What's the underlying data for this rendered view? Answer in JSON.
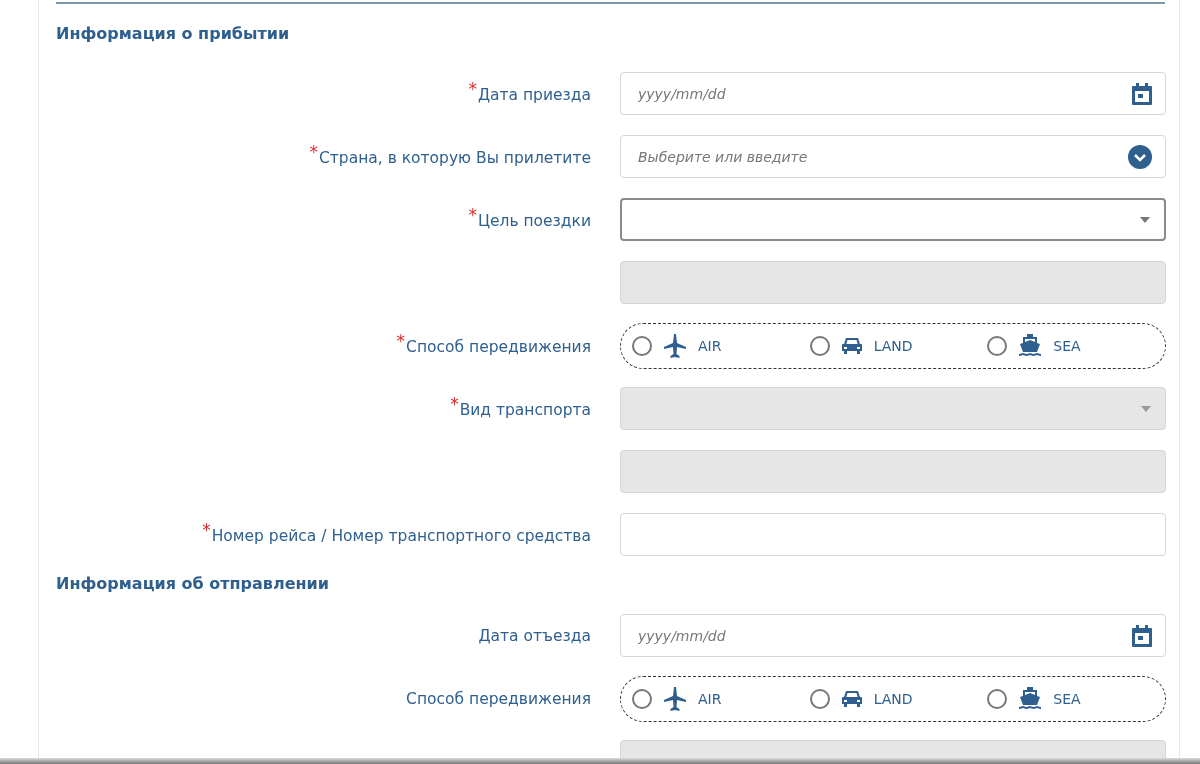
{
  "sections": [
    {
      "title": "Информация о прибытии",
      "fields": [
        {
          "kind": "date",
          "mark": "*",
          "label": "Дата приезда",
          "placeholder": "yyyy/mm/dd",
          "disabled": false
        },
        {
          "kind": "combo",
          "mark": "*",
          "label": "Страна, в которую Вы прилетите",
          "placeholder": "Выберите или введите",
          "disabled": false
        },
        {
          "kind": "select",
          "mark": "*",
          "label": "Цель поездки",
          "disabled": false,
          "focused": true
        },
        {
          "kind": "text",
          "disabled": true
        },
        {
          "kind": "transport",
          "mark": "*",
          "label": "Способ передвижения",
          "options": [
            {
              "kind": "air",
              "label": "AIR",
              "selected": false
            },
            {
              "kind": "land",
              "label": "LAND",
              "selected": false
            },
            {
              "kind": "sea",
              "label": "SEA",
              "selected": false
            }
          ]
        },
        {
          "kind": "select",
          "mark": "*",
          "label": "Вид транспорта",
          "disabled": true,
          "focused": false
        },
        {
          "kind": "text",
          "disabled": true
        },
        {
          "kind": "text",
          "mark": "*",
          "label": "Номер рейса / Номер транспортного средства",
          "disabled": false
        }
      ]
    },
    {
      "title": "Информация об отправлении",
      "fields": [
        {
          "kind": "date",
          "label": "Дата отъезда",
          "placeholder": "yyyy/mm/dd",
          "disabled": false
        },
        {
          "kind": "transport",
          "label": "Способ передвижения",
          "options": [
            {
              "kind": "air",
              "label": "AIR",
              "selected": false
            },
            {
              "kind": "land",
              "label": "LAND",
              "selected": false
            },
            {
              "kind": "sea",
              "label": "SEA",
              "selected": false
            }
          ]
        },
        {
          "kind": "text",
          "disabled": true
        }
      ]
    }
  ]
}
